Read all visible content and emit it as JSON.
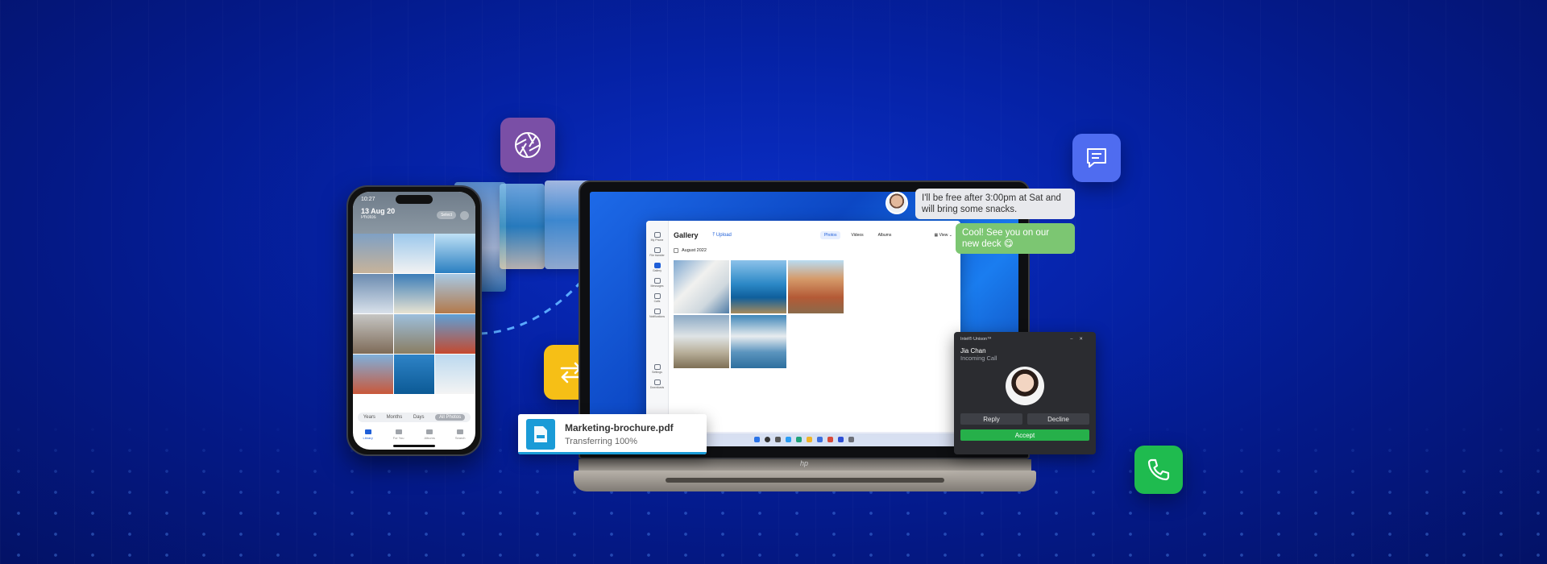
{
  "phone": {
    "time": "10:27",
    "date": "13 Aug 20",
    "subtitle": "Photos",
    "select_label": "Select",
    "segments": [
      "Years",
      "Months",
      "Days",
      "All Photos"
    ],
    "active_segment": "All Photos",
    "tabs": [
      "Library",
      "For You",
      "Albums",
      "Search"
    ],
    "active_tab": "Library"
  },
  "gallery_app": {
    "title": "Gallery",
    "upload_label": "Upload",
    "tabs": [
      "Photos",
      "Videos",
      "Albums"
    ],
    "active_tab": "Photos",
    "view_label": "View",
    "date_group": "August 2022",
    "sidebar_items": [
      "My Phone",
      "File transfer",
      "Gallery",
      "Messages",
      "Calls",
      "Notifications",
      "Settings",
      "Downloads"
    ],
    "active_sidebar_item": "Gallery"
  },
  "chat": {
    "incoming": "I'll be free after 3:00pm at Sat and will bring some snacks.",
    "outgoing": "Cool! See you on our new deck 😋"
  },
  "call": {
    "app_name": "Intel® Unison™",
    "caller": "Jia Chan",
    "status": "Incoming Call",
    "reply_label": "Reply",
    "decline_label": "Decline",
    "accept_label": "Accept"
  },
  "file_transfer": {
    "filename": "Marketing-brochure.pdf",
    "status": "Transferring 100%",
    "progress": 1.0
  },
  "laptop": {
    "brand": "hp"
  },
  "icons": {
    "photos_tile": "aperture-icon",
    "chat_tile": "chat-icon",
    "transfer_tile": "transfer-arrows-icon",
    "phone_tile": "phone-icon"
  },
  "colors": {
    "background": "#0522a6",
    "photos_tile": "#7a4fa6",
    "chat_tile": "#4f6cf0",
    "transfer_tile": "#f6bf16",
    "phone_tile": "#1fbb4f",
    "accept": "#26b04a",
    "outgoing_bubble": "#7cc672"
  }
}
